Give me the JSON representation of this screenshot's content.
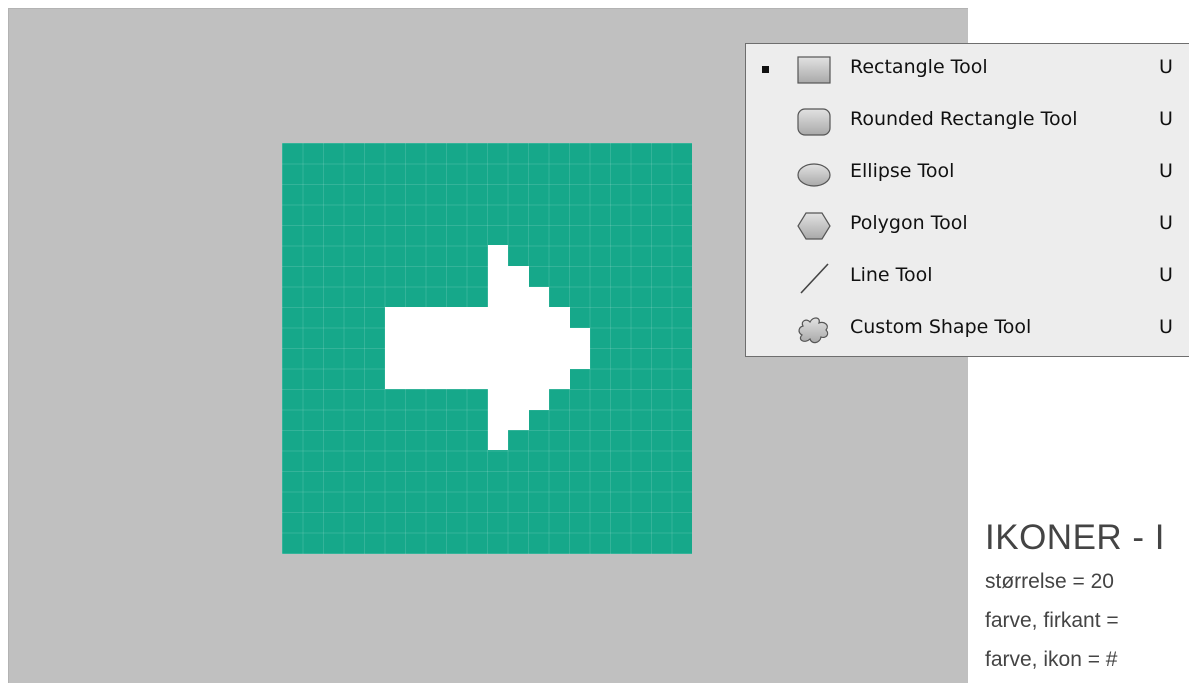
{
  "canvas": {
    "background_color": "#c0c0c0",
    "icon_square_color": "#16a88a",
    "arrow_color": "#ffffff",
    "arrow_icon": "right-arrow-icon"
  },
  "tool_menu": {
    "items": [
      {
        "label": "Rectangle Tool",
        "shortcut": "U",
        "icon": "rectangle-icon",
        "selected": true
      },
      {
        "label": "Rounded Rectangle Tool",
        "shortcut": "U",
        "icon": "rounded-rectangle-icon",
        "selected": false
      },
      {
        "label": "Ellipse Tool",
        "shortcut": "U",
        "icon": "ellipse-icon",
        "selected": false
      },
      {
        "label": "Polygon Tool",
        "shortcut": "U",
        "icon": "polygon-icon",
        "selected": false
      },
      {
        "label": "Line Tool",
        "shortcut": "U",
        "icon": "line-icon",
        "selected": false
      },
      {
        "label": "Custom Shape Tool",
        "shortcut": "U",
        "icon": "custom-shape-icon",
        "selected": false
      }
    ]
  },
  "notes": {
    "title": "IKONER - I",
    "lines": [
      "størrelse = 20",
      "farve, firkant =",
      "farve, ikon = #"
    ]
  }
}
